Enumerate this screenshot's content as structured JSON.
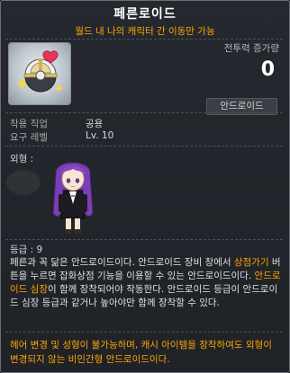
{
  "item": {
    "name": "페른로이드",
    "subtitle": "월드 내 나의 캐릭터 간 이동만 가능",
    "icon": "android-heart-ball-icon"
  },
  "combat_power": {
    "label": "전투력 증가량",
    "value": "0"
  },
  "category": "안드로이드",
  "requirements": {
    "job_label": "착용 직업",
    "job_value": "공용",
    "level_label": "요구 레벨",
    "level_value": "Lv. 10"
  },
  "appearance": {
    "label": "외형 :",
    "character_icon": "purple-hair-android-icon"
  },
  "grade": "등급 : 9",
  "description": {
    "part1": "페른과 꼭 닮은 안드로이드이다. 안드로이드 장비 창에서 ",
    "highlight1": "상점가기",
    "part2": " 버튼을 누르면 잡화상점 기능을 이용할 수 있는 안드로이드이다. ",
    "highlight2": "안드로이드 심장",
    "part3": "이 함께 장착되어야 작동한다. 안드로이드 등급이 안드로이드 심장 등급과 같거나 높아야만 함께 장착할 수 있다."
  },
  "warning": "헤어 변경 및 성형이 불가능하며, 캐시 아이템을 장착하여도 외형이 변경되지 않는 비인간형 안드로이드이다.",
  "colors": {
    "highlight": "#ffa500",
    "title": "#ffffff",
    "background": "#1f2227"
  }
}
